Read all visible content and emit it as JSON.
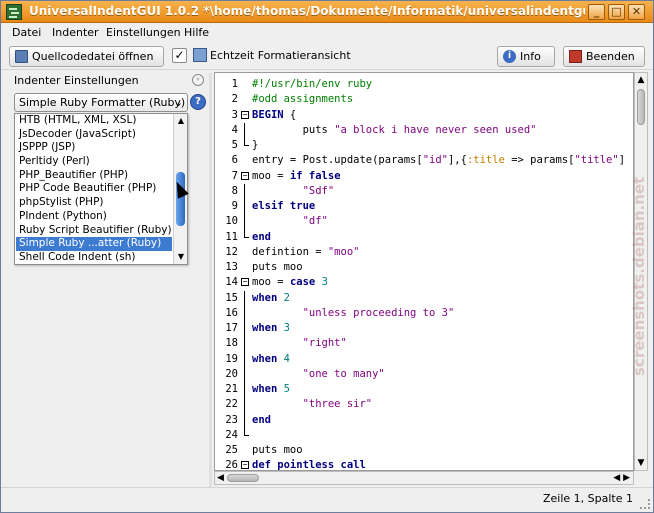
{
  "window": {
    "title": "UniversalIndentGUI 1.0.2 *\\home/thomas/Dokumente/Informatik/universalindentgui/universalin",
    "controls": {
      "minimize": "_",
      "maximize": "□",
      "close": "✕"
    }
  },
  "menubar": {
    "items": [
      "Datei",
      "Indenter",
      "Einstellungen",
      "Hilfe"
    ]
  },
  "toolbar": {
    "open_label": "Quellcodedatei öffnen",
    "live_preview_label": "Echtzeit Formatieransicht",
    "live_preview_checked": "✓",
    "info_label": "Info",
    "exit_label": "Beenden"
  },
  "indenter_panel": {
    "title": "Indenter Einstellungen",
    "selected": "Simple Ruby Formatter (Ruby)",
    "help_icon": "?",
    "list": [
      "HTB (HTML, XML, XSL)",
      "JsDecoder (JavaScript)",
      "JSPPP (JSP)",
      "Perltidy (Perl)",
      "PHP_Beautifier (PHP)",
      "PHP Code Beautifier (PHP)",
      "phpStylist (PHP)",
      "PIndent (Python)",
      "Ruby Script Beautifier (Ruby)",
      "Simple Ruby ...atter (Ruby)",
      "Shell Code Indent (sh)"
    ],
    "selected_index": 9
  },
  "editor": {
    "lines": [
      {
        "n": "1",
        "code": "<span class=\"cm\">#!/usr/bin/env ruby</span>"
      },
      {
        "n": "2",
        "code": "<span class=\"cm\">#odd assignments</span>"
      },
      {
        "n": "3",
        "code": "<span class=\"kw\">BEGIN</span> {",
        "fold": "minus"
      },
      {
        "n": "4",
        "code": "        puts <span class=\"str\">\"a block i have never seen used\"</span>",
        "fold": "line"
      },
      {
        "n": "5",
        "code": "}",
        "fold": "end"
      },
      {
        "n": "6",
        "code": "entry = Post.update(params[<span class=\"str\">\"id\"</span>],{<span class=\"sym\">:title</span> => params[<span class=\"str\">\"title\"</span>]"
      },
      {
        "n": "7",
        "code": "moo = <span class=\"kw\">if false</span>",
        "fold": "minus"
      },
      {
        "n": "8",
        "code": "        <span class=\"str\">\"Sdf\"</span>",
        "fold": "line"
      },
      {
        "n": "9",
        "code": "<span class=\"kw\">elsif true</span>",
        "fold": "line"
      },
      {
        "n": "10",
        "code": "        <span class=\"str\">\"df\"</span>",
        "fold": "line"
      },
      {
        "n": "11",
        "code": "<span class=\"kw\">end</span>",
        "fold": "end"
      },
      {
        "n": "12",
        "code": "defintion = <span class=\"str\">\"moo\"</span>"
      },
      {
        "n": "13",
        "code": "puts moo"
      },
      {
        "n": "14",
        "code": "moo = <span class=\"kw\">case</span> <span class=\"num\">3</span>",
        "fold": "minus"
      },
      {
        "n": "15",
        "code": "<span class=\"kw\">when</span> <span class=\"num\">2</span>",
        "fold": "line"
      },
      {
        "n": "16",
        "code": "        <span class=\"str\">\"unless proceeding to 3\"</span>",
        "fold": "line"
      },
      {
        "n": "17",
        "code": "<span class=\"kw\">when</span> <span class=\"num\">3</span>",
        "fold": "line"
      },
      {
        "n": "18",
        "code": "        <span class=\"str\">\"right\"</span>",
        "fold": "line"
      },
      {
        "n": "19",
        "code": "<span class=\"kw\">when</span> <span class=\"num\">4</span>",
        "fold": "line"
      },
      {
        "n": "20",
        "code": "        <span class=\"str\">\"one to many\"</span>",
        "fold": "line"
      },
      {
        "n": "21",
        "code": "<span class=\"kw\">when</span> <span class=\"num\">5</span>",
        "fold": "line"
      },
      {
        "n": "22",
        "code": "        <span class=\"str\">\"three sir\"</span>",
        "fold": "line"
      },
      {
        "n": "23",
        "code": "<span class=\"kw\">end</span>",
        "fold": "line"
      },
      {
        "n": "24",
        "code": "",
        "fold": "end"
      },
      {
        "n": "25",
        "code": "puts moo"
      },
      {
        "n": "26",
        "code": "<span class=\"kw\">def pointless call</span>",
        "fold": "minus"
      }
    ]
  },
  "statusbar": {
    "position": "Zeile 1, Spalte 1"
  },
  "watermark": "screenshots.debian.net"
}
